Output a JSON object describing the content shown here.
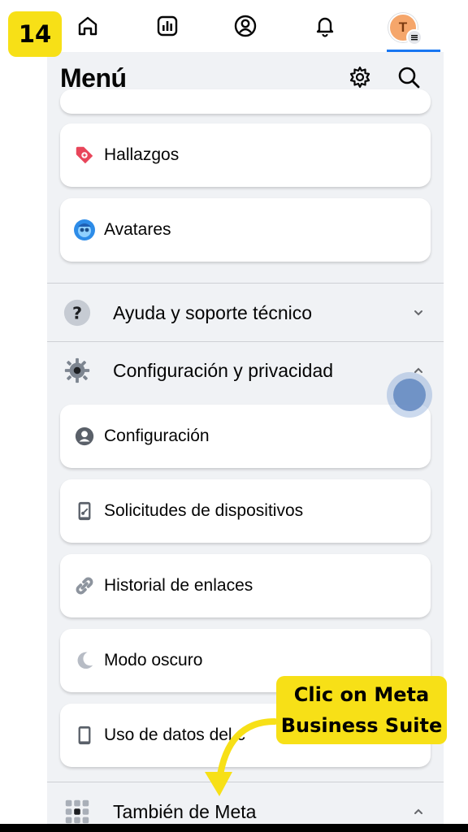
{
  "step": "14",
  "tabs": [
    {
      "icon": "home-icon"
    },
    {
      "icon": "dashboard-icon"
    },
    {
      "icon": "profile-icon"
    },
    {
      "icon": "bell-icon"
    },
    {
      "icon": "menu-avatar",
      "avatar_initial": "T",
      "active": true
    }
  ],
  "header": {
    "title": "Menú",
    "icons": [
      "gear-icon",
      "search-icon"
    ]
  },
  "shortcuts": [
    {
      "label": "Hallazgos",
      "icon": "tag-icon"
    },
    {
      "label": "Avatares",
      "icon": "avatar-face-icon"
    }
  ],
  "sections": {
    "help": {
      "label": "Ayuda y soporte técnico",
      "icon": "question-icon",
      "expanded": false
    },
    "settings": {
      "label": "Configuración y privacidad",
      "icon": "gear-icon",
      "expanded": true
    },
    "meta": {
      "label": "También de Meta",
      "icon": "grid-icon",
      "expanded": true
    }
  },
  "settings_items": [
    {
      "label": "Configuración",
      "icon": "person-circle-icon"
    },
    {
      "label": "Solicitudes de dispositivos",
      "icon": "device-request-icon"
    },
    {
      "label": "Historial de enlaces",
      "icon": "link-icon"
    },
    {
      "label": "Modo oscuro",
      "icon": "moon-icon"
    },
    {
      "label": "Uso de datos del c",
      "icon": "phone-icon"
    }
  ],
  "callout": {
    "line1": "Clic on Meta",
    "line2": "Business Suite"
  },
  "colors": {
    "accent": "#1877f2",
    "highlight": "#f7e017",
    "background": "#f0f2f5"
  }
}
